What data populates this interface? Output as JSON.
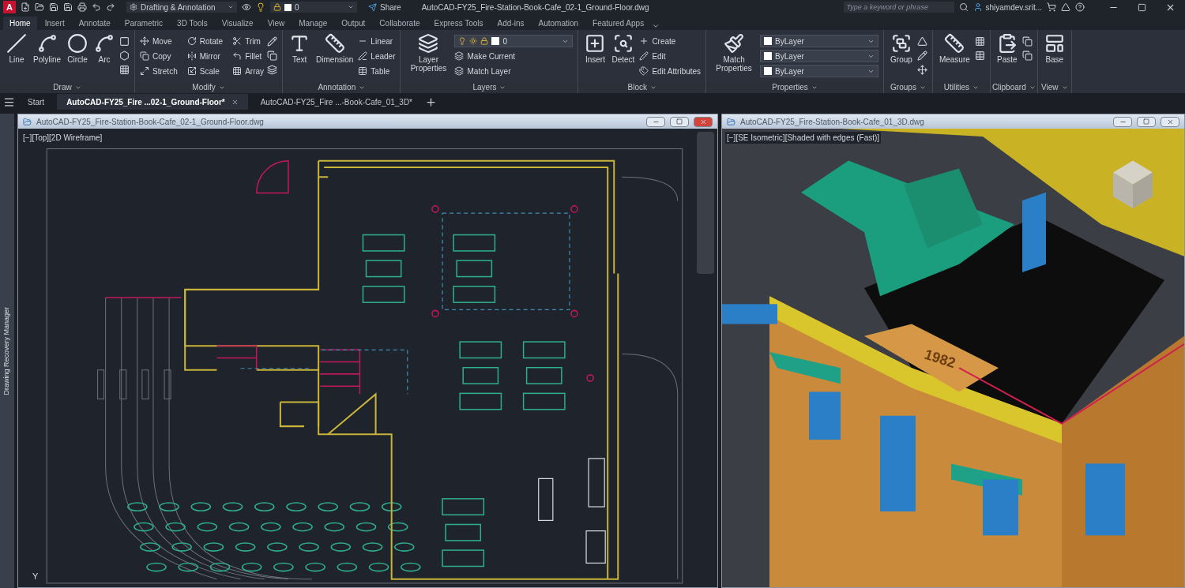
{
  "title_bar": {
    "logo": "A",
    "workspace": "Drafting & Annotation",
    "layer": "0",
    "share": "Share",
    "title": "AutoCAD-FY25_Fire-Station-Book-Cafe_02-1_Ground-Floor.dwg",
    "search_placeholder": "Type a keyword or phrase",
    "user": "shiyamdev.srit..."
  },
  "ribbon_tabs": [
    {
      "label": "Home",
      "selected": true
    },
    {
      "label": "Insert",
      "selected": false
    },
    {
      "label": "Annotate",
      "selected": false
    },
    {
      "label": "Parametric",
      "selected": false
    },
    {
      "label": "3D Tools",
      "selected": false
    },
    {
      "label": "Visualize",
      "selected": false
    },
    {
      "label": "View",
      "selected": false
    },
    {
      "label": "Manage",
      "selected": false
    },
    {
      "label": "Output",
      "selected": false
    },
    {
      "label": "Collaborate",
      "selected": false
    },
    {
      "label": "Express Tools",
      "selected": false
    },
    {
      "label": "Add-ins",
      "selected": false
    },
    {
      "label": "Automation",
      "selected": false
    },
    {
      "label": "Featured Apps",
      "selected": false
    }
  ],
  "ribbon_panels": [
    {
      "kind": "draw",
      "title": "Draw",
      "large": [
        "Line",
        "Polyline",
        "Circle",
        "Arc"
      ]
    },
    {
      "kind": "modify",
      "title": "Modify",
      "small": [
        "Move",
        "Copy",
        "Stretch",
        "Rotate",
        "Mirror",
        "Scale",
        "Trim",
        "Fillet",
        "Array"
      ]
    },
    {
      "kind": "annotation",
      "title": "Annotation",
      "large": [
        "Text",
        "Dimension"
      ],
      "small": [
        "Linear",
        "Leader",
        "Table"
      ]
    },
    {
      "kind": "layers",
      "title": "Layers",
      "large": [
        "Layer Properties"
      ],
      "small": [
        "Make Current",
        "Match Layer"
      ],
      "selects": [
        "0"
      ]
    },
    {
      "kind": "block",
      "title": "Block",
      "large": [
        "Insert",
        "Detect"
      ],
      "small": [
        "Create",
        "Edit",
        "Edit Attributes"
      ]
    },
    {
      "kind": "properties",
      "title": "Properties",
      "large": [
        "Match Properties"
      ],
      "selects": [
        "ByLayer",
        "ByLayer",
        "ByLayer"
      ]
    },
    {
      "kind": "groups",
      "title": "Groups",
      "large": [
        "Group"
      ]
    },
    {
      "kind": "utilities",
      "title": "Utilities",
      "large": [
        "Measure"
      ]
    },
    {
      "kind": "clipboard",
      "title": "Clipboard",
      "large": [
        "Paste"
      ]
    },
    {
      "kind": "view",
      "title": "View",
      "large": [
        "Base"
      ]
    }
  ],
  "file_tabs": [
    {
      "label": "Start",
      "selected": false,
      "closable": false
    },
    {
      "label": "AutoCAD-FY25_Fire ...02-1_Ground-Floor*",
      "selected": true,
      "closable": true
    },
    {
      "label": "AutoCAD-FY25_Fire ...-Book-Cafe_01_3D*",
      "selected": false,
      "closable": false
    }
  ],
  "side_palette": {
    "label": "Drawing Recovery Manager"
  },
  "windows": [
    {
      "kind": "plan",
      "title": "AutoCAD-FY25_Fire-Station-Book-Cafe_02-1_Ground-Floor.dwg",
      "viewport_label": "[−][Top][2D Wireframe]",
      "ucs_label": "Y"
    },
    {
      "kind": "model",
      "title": "AutoCAD-FY25_Fire-Station-Book-Cafe_01_3D.dwg",
      "viewport_label": "[−][SE Isometric][Shaded with edges (Fast)]",
      "facade_text": "1982"
    }
  ]
}
